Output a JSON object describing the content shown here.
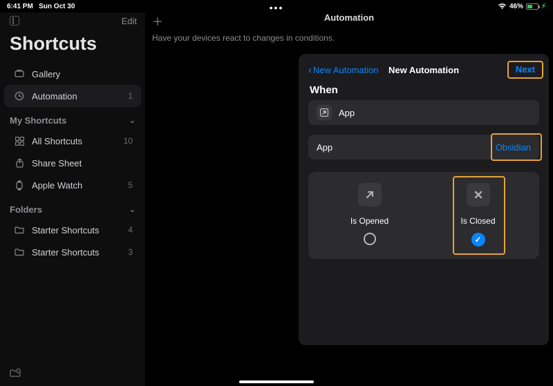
{
  "status": {
    "time": "6:41 PM",
    "date": "Sun Oct 30",
    "battery_pct": "46%"
  },
  "sidebar": {
    "edit": "Edit",
    "title": "Shortcuts",
    "nav": {
      "gallery": "Gallery",
      "automation": "Automation",
      "automation_count": "1"
    },
    "sections": {
      "my_shortcuts": "My Shortcuts",
      "all_shortcuts": "All Shortcuts",
      "all_shortcuts_count": "10",
      "share_sheet": "Share Sheet",
      "apple_watch": "Apple Watch",
      "apple_watch_count": "5",
      "folders": "Folders",
      "folder1": "Starter Shortcuts",
      "folder1_count": "4",
      "folder2": "Starter Shortcuts",
      "folder2_count": "3"
    }
  },
  "main": {
    "title": "Automation",
    "subtitle": "Have your devices react to changes in conditions."
  },
  "modal": {
    "back": "New Automation",
    "title": "New Automation",
    "next": "Next",
    "when": "When",
    "app_row_label": "App",
    "app_select_label": "App",
    "app_select_value": "Obsidian",
    "opt_open": "Is Opened",
    "opt_close": "Is Closed"
  }
}
